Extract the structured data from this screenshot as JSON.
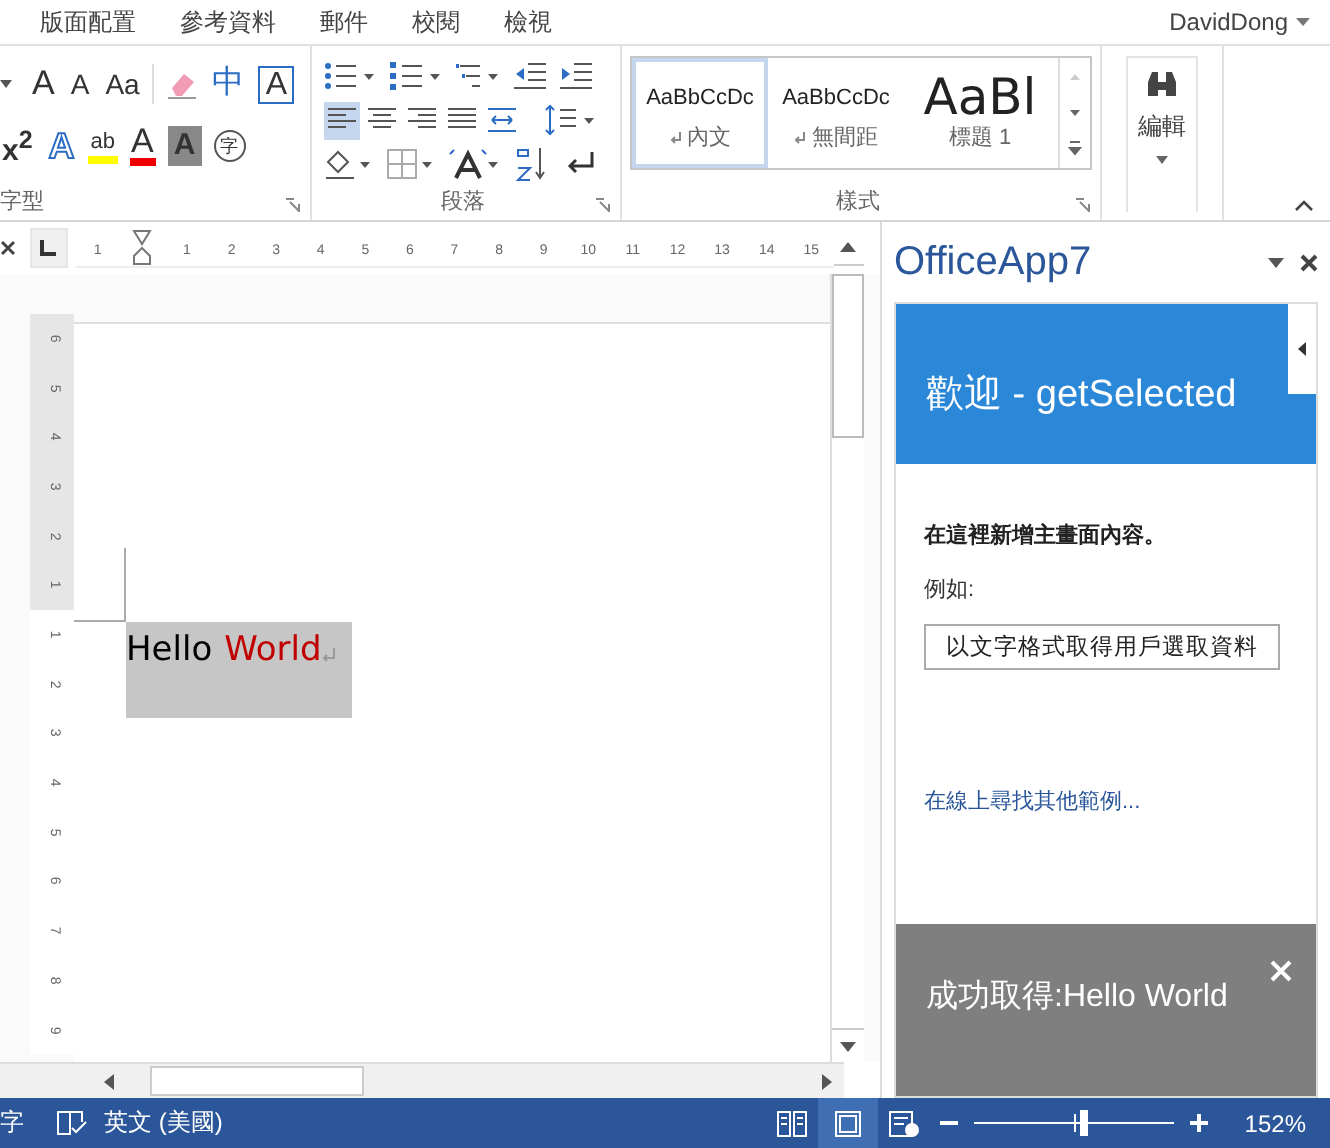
{
  "menu_tabs": [
    {
      "label": "版面配置",
      "selected": false
    },
    {
      "label": "參考資料",
      "selected": false
    },
    {
      "label": "郵件",
      "selected": false
    },
    {
      "label": "校閱",
      "selected": false
    },
    {
      "label": "檢視",
      "selected": false
    }
  ],
  "user": "DavidDong",
  "ribbon": {
    "font_group": {
      "label": "字型",
      "row1": [
        {
          "kind": "grow",
          "text": "A"
        },
        {
          "kind": "shrink",
          "text": "A"
        },
        {
          "kind": "case",
          "text": "Aa"
        },
        {
          "kind": "eraser"
        },
        {
          "kind": "phonetic",
          "text": "中"
        },
        {
          "kind": "boxed",
          "text": "A"
        }
      ],
      "row2": [
        {
          "kind": "superscript",
          "text": "x$^{2}$"
        },
        {
          "kind": "outline",
          "text": "A"
        },
        {
          "kind": "highlight",
          "text": "ab"
        },
        {
          "kind": "fontcolor",
          "text": "A"
        },
        {
          "kind": "shaded",
          "text": "A"
        },
        {
          "kind": "circled",
          "text": "字"
        }
      ]
    },
    "paragraph_group": {
      "label": "段落",
      "align_buttons": [
        {
          "kind": "left",
          "selected": true
        },
        {
          "kind": "center",
          "selected": false
        },
        {
          "kind": "right",
          "selected": false
        },
        {
          "kind": "justify",
          "selected": false
        },
        {
          "kind": "distributed",
          "selected": false
        }
      ]
    },
    "styles_group": {
      "label": "樣式",
      "styles": [
        {
          "sample": "AaBbCcDc",
          "name": "內文",
          "kind": "body",
          "selected": true
        },
        {
          "sample": "AaBbCcDc",
          "name": "無間距",
          "kind": "body",
          "selected": false
        },
        {
          "sample": "AaBl",
          "name": "標題 1",
          "kind": "heading",
          "selected": false
        }
      ]
    },
    "editing_group": {
      "label": "編輯"
    }
  },
  "ruler": {
    "left_number": "1",
    "numbers": [
      "1",
      "2",
      "3",
      "4",
      "5",
      "6",
      "7",
      "8",
      "9",
      "10",
      "11",
      "12",
      "13",
      "14",
      "15"
    ],
    "vertical_above": [
      "6",
      "5",
      "4",
      "3",
      "2",
      "1"
    ],
    "vertical_below": [
      "1",
      "2",
      "3",
      "4",
      "5",
      "6",
      "7",
      "8",
      "9"
    ]
  },
  "document": {
    "selected": true,
    "runs": [
      {
        "text": "Hello",
        "color": "#000000"
      },
      {
        "text": "World",
        "color": "#c00000"
      }
    ]
  },
  "task_pane": {
    "title": "OfficeApp7",
    "header": "歡迎 - getSelected",
    "intro": "在這裡新增主畫面內容。",
    "example_label": "例如:",
    "action_button": "以文字格式取得用戶選取資料",
    "link": "在線上尋找其他範例...",
    "notification": "成功取得:Hello World"
  },
  "status_bar": {
    "word_count": "字",
    "language": "英文 (美國)",
    "views": [
      {
        "kind": "read",
        "selected": false
      },
      {
        "kind": "print",
        "selected": true
      },
      {
        "kind": "web",
        "selected": false
      }
    ],
    "zoom": {
      "level": 0.55,
      "reading": "152%"
    }
  }
}
